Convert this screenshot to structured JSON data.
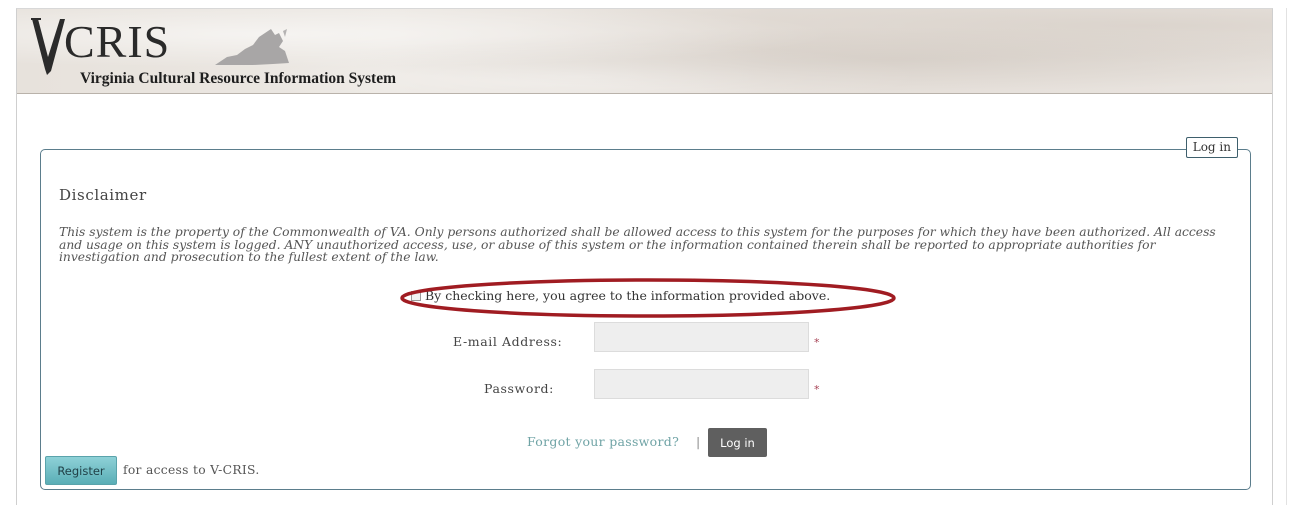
{
  "header": {
    "logo_word": "CRIS",
    "subtitle": "Virginia Cultural Resource Information System"
  },
  "panel": {
    "legend": "Log in",
    "disclaimer_title": "Disclaimer",
    "disclaimer_text": "This system is the property of the Commonwealth of VA. Only persons authorized shall be allowed access to this system for the purposes for which they have been authorized. All access and usage on this system is logged. ANY unauthorized access, use, or abuse of this system or the information contained therein shall be reported to appropriate authorities for investigation and prosecution to the fullest extent of the law.",
    "agree_label": "By checking here, you agree to the information provided above."
  },
  "form": {
    "email_label": "E-mail Address:",
    "email_value": "",
    "password_label": "Password:",
    "password_value": "",
    "required_mark": "*",
    "forgot_link": "Forgot your password?",
    "separator": "|",
    "login_button": "Log in"
  },
  "register": {
    "button": "Register",
    "text": "for access to V-CRIS."
  },
  "colors": {
    "panel_border": "#5b7d8c",
    "highlight": "#a01c22",
    "register_button": "#6cbfc6",
    "login_button": "#5f5f5f",
    "required": "#a64154",
    "link": "#6fa3a5"
  },
  "icons": [
    "virginia-state-icon",
    "checkmark-v-icon"
  ]
}
